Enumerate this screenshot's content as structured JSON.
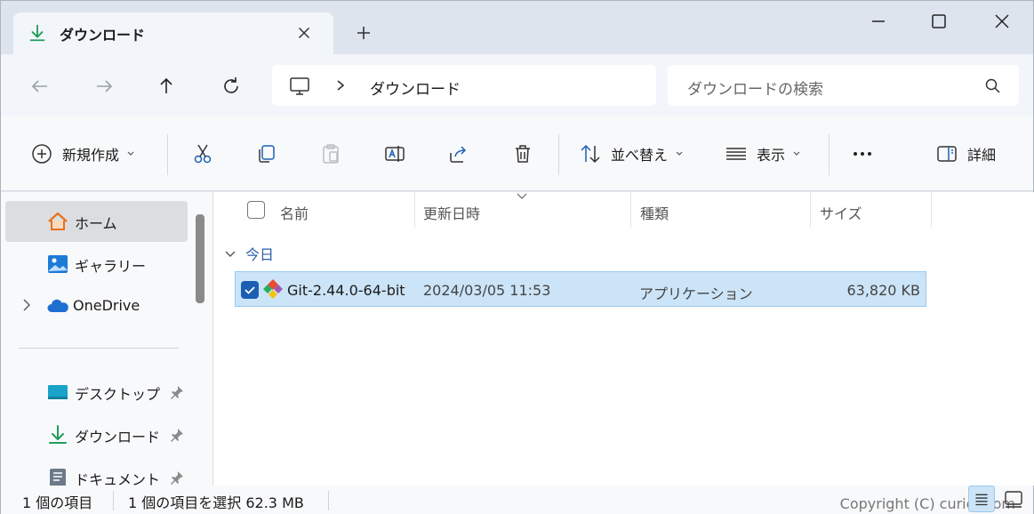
{
  "tab": {
    "title": "ダウンロード"
  },
  "address": {
    "crumb": "ダウンロード",
    "search_placeholder": "ダウンロードの検索"
  },
  "commands": {
    "new": "新規作成",
    "sort": "並べ替え",
    "view": "表示",
    "details": "詳細"
  },
  "nav": {
    "items": [
      {
        "label": "ホーム"
      },
      {
        "label": "ギャラリー"
      },
      {
        "label": "OneDrive"
      },
      {
        "label": "デスクトップ"
      },
      {
        "label": "ダウンロード"
      },
      {
        "label": "ドキュメント"
      }
    ]
  },
  "columns": {
    "name": "名前",
    "modified": "更新日時",
    "type": "種類",
    "size": "サイズ"
  },
  "group": {
    "label": "今日"
  },
  "file": {
    "name": "Git-2.44.0-64-bit",
    "modified": "2024/03/05 11:53",
    "type": "アプリケーション",
    "size": "63,820 KB"
  },
  "status": {
    "count": "1 個の項目",
    "selection": "1 個の項目を選択  62.3 MB",
    "watermark": "Copyright (C) curiet.com"
  },
  "colors": {
    "accent": "#1a5fb4",
    "selection": "#cce4f7",
    "download": "#1e9e5a"
  }
}
